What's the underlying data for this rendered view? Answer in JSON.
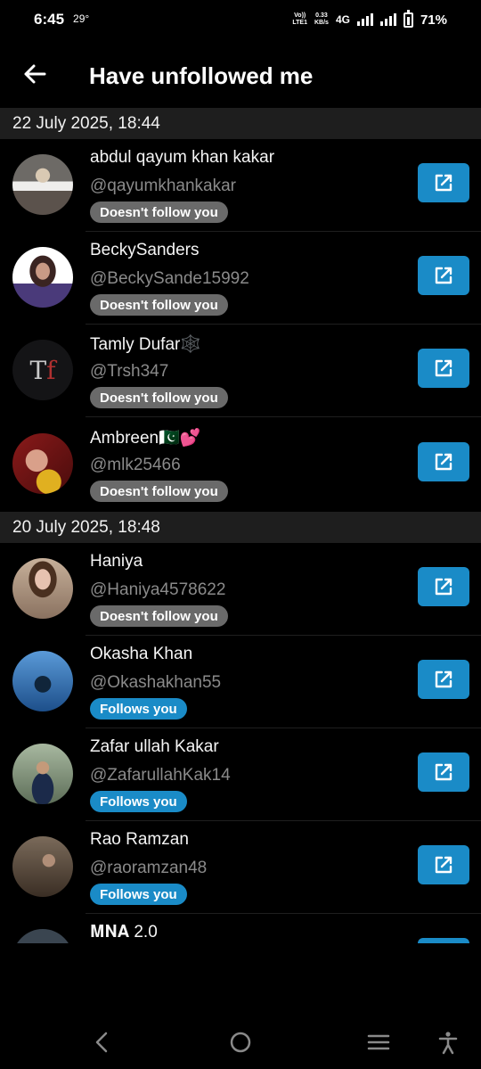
{
  "status": {
    "time": "6:45",
    "temp": "29°",
    "volte_top": "Vo))",
    "volte_bottom": "LTE1",
    "speed_top": "0.33",
    "speed_bottom": "KB/s",
    "network": "4G",
    "battery": "71%"
  },
  "header": {
    "title": "Have unfollowed me"
  },
  "sections": [
    {
      "date": "22 July 2025, 18:44"
    },
    {
      "date": "20 July 2025, 18:48"
    }
  ],
  "users": [
    {
      "name": "abdul qayum khan kakar",
      "handle": "@qayumkhankakar",
      "badge": "Doesn't follow you",
      "badge_type": "gray"
    },
    {
      "name": "BeckySanders",
      "handle": "@BeckySande15992",
      "badge": "Doesn't follow you",
      "badge_type": "gray"
    },
    {
      "name": "Tamly Dufar🕸️",
      "handle": "@Trsh347",
      "badge": "Doesn't follow you",
      "badge_type": "gray"
    },
    {
      "name": "Ambreen🇵🇰💕",
      "handle": "@mlk25466",
      "badge": "Doesn't follow you",
      "badge_type": "gray"
    },
    {
      "name": "Haniya",
      "handle": "@Haniya4578622",
      "badge": "Doesn't follow you",
      "badge_type": "gray"
    },
    {
      "name": "Okasha Khan",
      "handle": "@Okashakhan55",
      "badge": "Follows you",
      "badge_type": "blue"
    },
    {
      "name": "Zafar ullah Kakar",
      "handle": "@ZafarullahKak14",
      "badge": "Follows you",
      "badge_type": "blue"
    },
    {
      "name": "Rao Ramzan",
      "handle": "@raoramzan48",
      "badge": "Follows you",
      "badge_type": "blue"
    },
    {
      "name": "𝐌𝐍𝐀 2.0"
    }
  ],
  "colors": {
    "accent": "#1a8bc7",
    "badge_gray": "#6a6a6a",
    "date_header_bg": "#1e1e1e",
    "background": "#000000"
  },
  "icons": {
    "back": "arrow-left-icon",
    "open": "external-link-icon",
    "nav_back": "chevron-left-icon",
    "nav_home": "circle-home-icon",
    "nav_recents": "menu-lines-icon",
    "nav_accessibility": "accessibility-icon"
  }
}
